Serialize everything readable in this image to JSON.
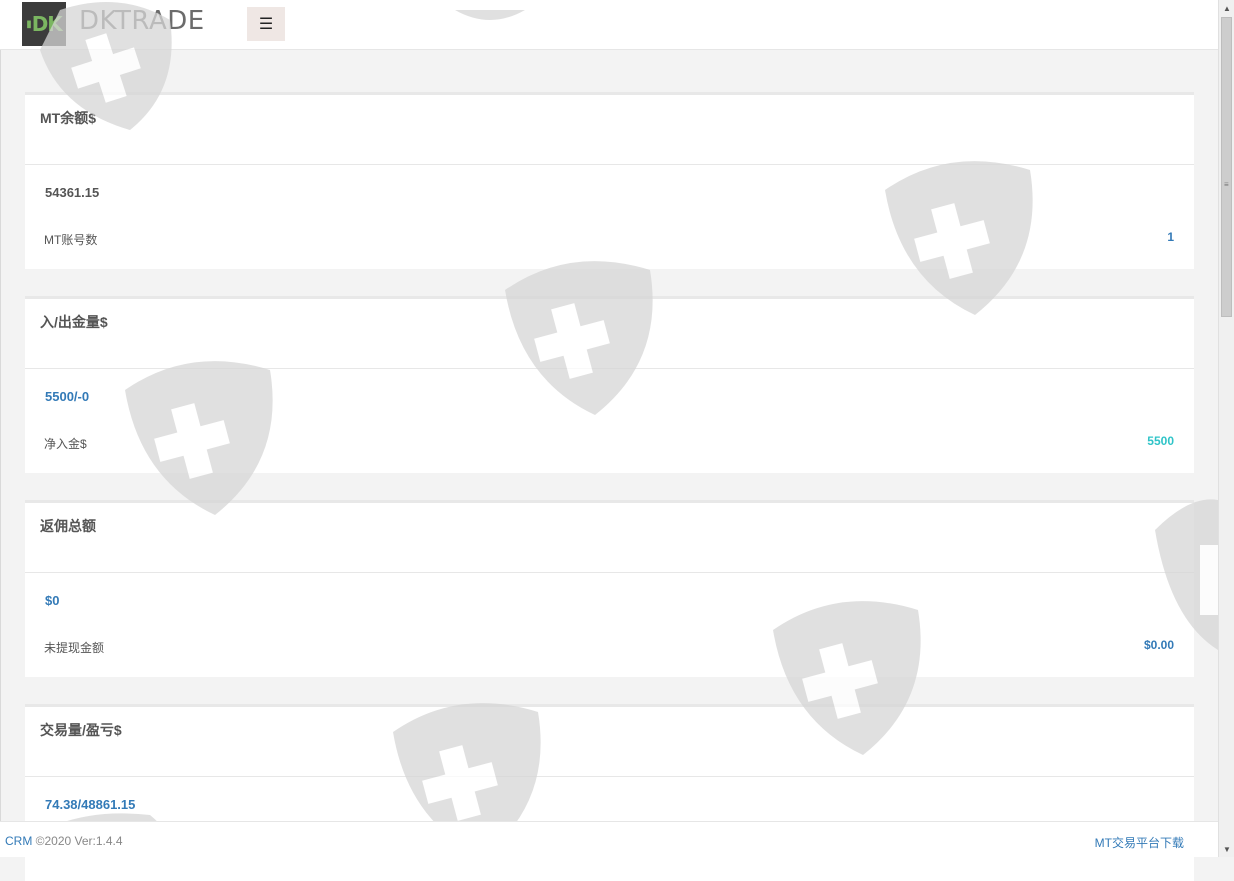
{
  "header": {
    "logo_text": "DK",
    "brand": "DKTRADE",
    "menu_icon": "hamburger-icon"
  },
  "cards": [
    {
      "title": "MT余额$",
      "value": "54361.15",
      "sub_label": "MT账号数",
      "sub_value": "1"
    },
    {
      "title": "入/出金量$",
      "value": "5500/-0",
      "sub_label": "净入金$",
      "sub_value": "5500"
    },
    {
      "title": "返佣总额",
      "value": "$0",
      "sub_label": "未提现金额",
      "sub_value": "$0.00"
    },
    {
      "title": "交易量/盈亏$",
      "value": "74.38/48861.15"
    }
  ],
  "footer": {
    "crm_link": "CRM",
    "copyright": " ©2020 Ver:1.4.4",
    "download_link": "MT交易平台下载"
  },
  "colors": {
    "accent_blue": "#337ab7",
    "teal": "#2fc4c8",
    "logo_green": "#7bb661"
  }
}
